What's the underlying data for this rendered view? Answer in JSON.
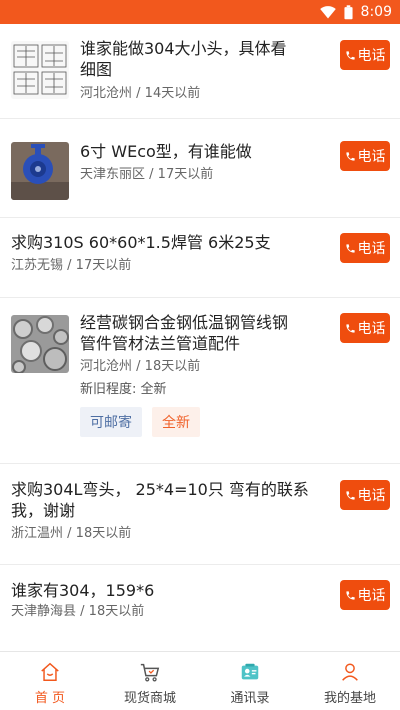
{
  "status_bar": {
    "time": "8:09",
    "icons": [
      "wifi-icon",
      "battery-icon"
    ]
  },
  "colors": {
    "accent": "#f2581d",
    "call_button": "#ef4d0e",
    "tag_blue_bg": "#eef1f7",
    "tag_blue_text": "#4d6ea3",
    "tag_orange_bg": "#fdf0ea",
    "tag_orange_text": "#f0612a"
  },
  "list": {
    "items": [
      {
        "title_line1": "谁家能做304大小头，具体看",
        "title_line2": "细图",
        "location": "河北沧州",
        "age": "14天以前",
        "thumbnail": "technical-drawing",
        "call_label": "电话"
      },
      {
        "title_line1": "6寸 WEco型，有谁能做",
        "location": "天津东丽区",
        "age": "17天以前",
        "thumbnail": "blue-valve",
        "call_label": "电话"
      },
      {
        "title_line1": "求购310S 60*60*1.5焊管 6米25支",
        "location": "江苏无锡",
        "age": "17天以前",
        "call_label": "电话"
      },
      {
        "title_line1": "经营碳钢合金钢低温钢管线钢",
        "title_line2": "管件管材法兰管道配件",
        "location": "河北沧州",
        "age": "18天以前",
        "thumbnail": "steel-fittings",
        "condition_label": "新旧程度:",
        "condition_value": "全新",
        "tags": [
          "可邮寄",
          "全新"
        ],
        "call_label": "电话"
      },
      {
        "title_line1": "求购304L弯头，  25*4=10只 弯有的联系",
        "title_line2": "我，谢谢",
        "location": "浙江温州",
        "age": "18天以前",
        "call_label": "电话"
      },
      {
        "title_line1": "谁家有304，159*6",
        "location": "天津静海县",
        "age": "18天以前",
        "call_label": "电话"
      }
    ],
    "separator": " / "
  },
  "tabbar": {
    "tabs": [
      {
        "label": "首 页",
        "icon": "home-icon",
        "active": true
      },
      {
        "label": "现货商城",
        "icon": "cart-icon",
        "active": false
      },
      {
        "label": "通讯录",
        "icon": "contacts-icon",
        "active": false
      },
      {
        "label": "我的基地",
        "icon": "user-icon",
        "active": false
      }
    ]
  }
}
